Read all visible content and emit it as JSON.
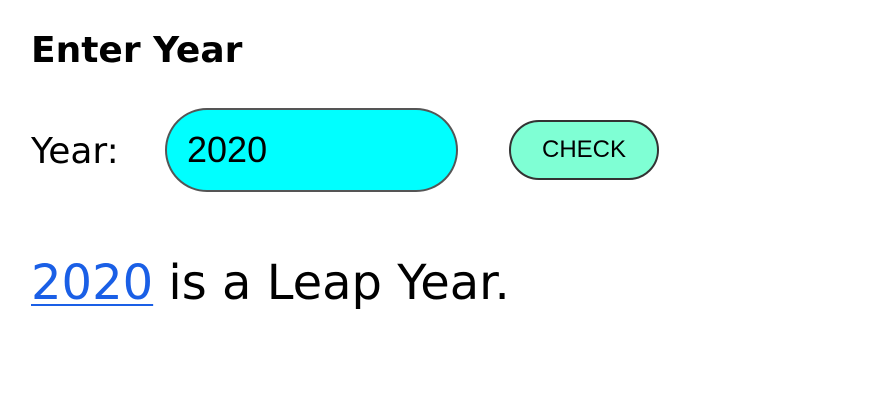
{
  "form": {
    "heading": "Enter Year",
    "year_label": "Year:",
    "year_value": "2020",
    "check_label": "CHECK"
  },
  "result": {
    "year": "2020",
    "message": " is a Leap Year."
  },
  "colors": {
    "input_background": "#00ffff",
    "button_background": "#7fffd4",
    "link": "#1a5fe6"
  }
}
